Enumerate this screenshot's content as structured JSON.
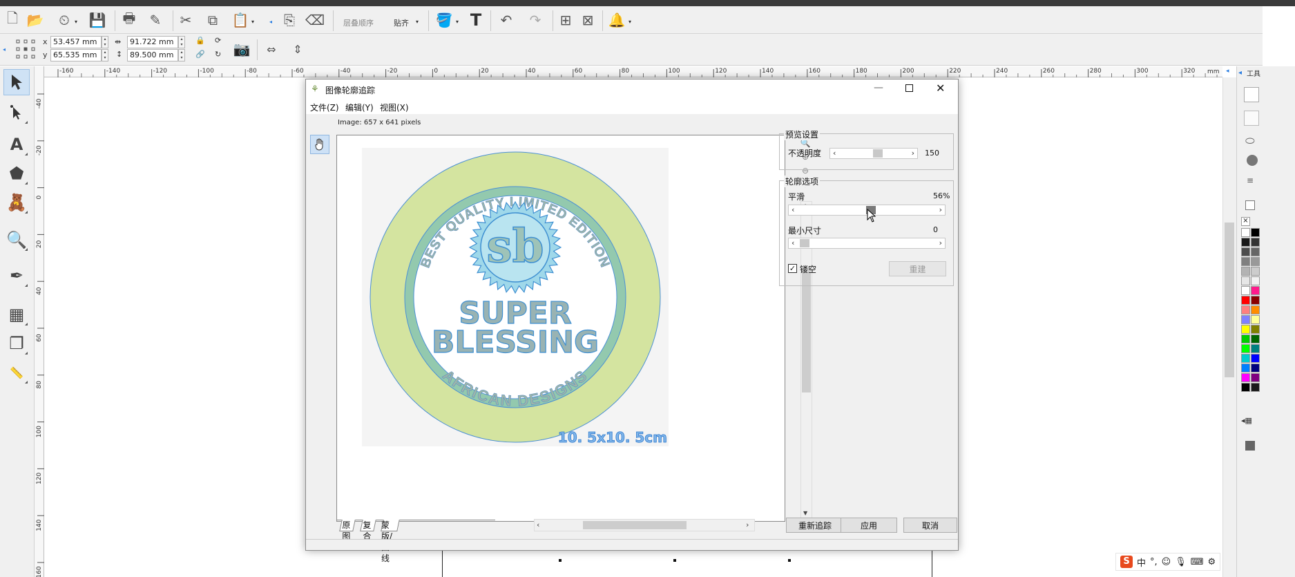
{
  "toolbar": {
    "layer_order_label": "层叠顺序",
    "snap_label": "贴齐"
  },
  "properties": {
    "x_label": "x",
    "y_label": "y",
    "x_value": "53.457 mm",
    "y_value": "65.535 mm",
    "width_value": "91.722 mm",
    "height_value": "89.500 mm"
  },
  "ruler": {
    "unit": "mm",
    "h_ticks": [
      "-160",
      "-140",
      "-120",
      "-100",
      "-80",
      "-60",
      "-40",
      "-20",
      "0",
      "20",
      "40",
      "60",
      "80",
      "100",
      "120",
      "140",
      "160",
      "180",
      "200",
      "220",
      "240",
      "260",
      "280",
      "300",
      "320",
      "340",
      "360"
    ],
    "v_ticks": [
      "-40",
      "-20",
      "0",
      "20",
      "40",
      "60",
      "80",
      "100",
      "120",
      "140",
      "160"
    ]
  },
  "right_panel": {
    "tab_label": "工具"
  },
  "dialog": {
    "title": "图像轮廓追踪",
    "menu": {
      "file": "文件(Z)",
      "edit": "编辑(Y)",
      "view": "视图(X)"
    },
    "image_info": "Image: 657 x 641 pixels",
    "preview_group": {
      "title": "预览设置",
      "opacity_label": "不透明度",
      "opacity_value": "150"
    },
    "contour_group": {
      "title": "轮廓选项",
      "smooth_label": "平滑",
      "smooth_value": "56%",
      "min_size_label": "最小尺寸",
      "min_size_value": "0",
      "hollow_label": "镂空",
      "hollow_checked": true,
      "rebuild_label": "重建"
    },
    "tabs": [
      "原图",
      "复合",
      "蒙版/曲线"
    ],
    "buttons": {
      "retrace": "重新追踪",
      "apply": "应用",
      "cancel": "取消"
    },
    "logo": {
      "arc_top": "BEST QUALITY LIMITED EDITION",
      "arc_bottom": "AFRICAN  DESIGNS",
      "monogram": "sb",
      "line1": "SUPER",
      "line2": "BLESSING",
      "size": "10. 5x10. 5cm"
    }
  },
  "ime": {
    "mode": "中"
  }
}
